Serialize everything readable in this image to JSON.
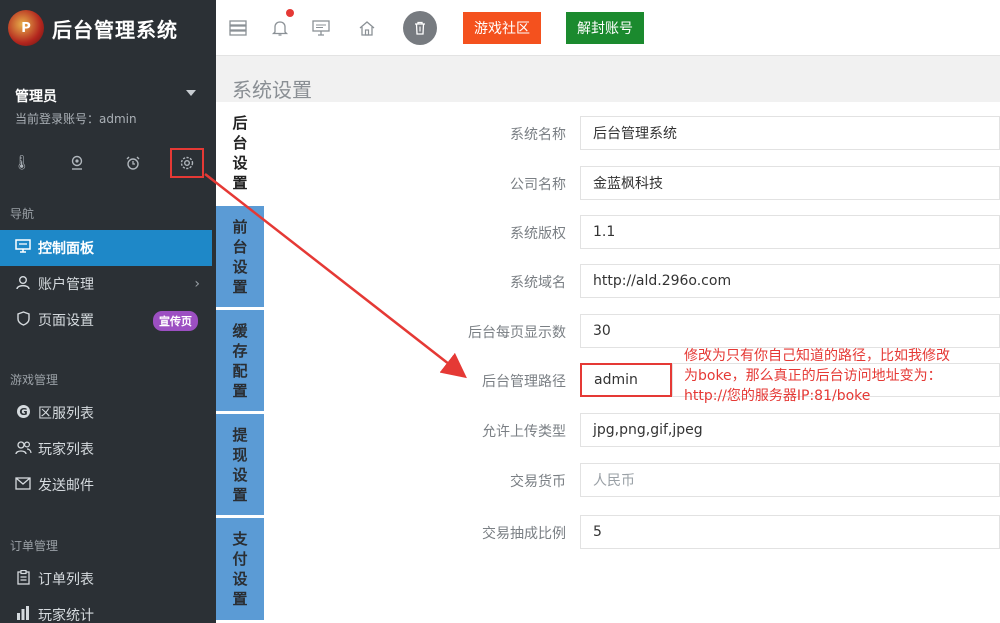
{
  "app": {
    "title": "后台管理系统",
    "logo_text": "P"
  },
  "user": {
    "name": "管理员",
    "login_info": "当前登录账号：admin"
  },
  "quick_icons": [
    "thermometer-icon",
    "location-icon",
    "alarm-icon",
    "gear-icon"
  ],
  "sidebar": {
    "nav_section": "导航",
    "items": [
      {
        "label": "控制面板",
        "icon": "monitor-icon"
      },
      {
        "label": "账户管理",
        "icon": "user-icon",
        "arrow": "›"
      },
      {
        "label": "页面设置",
        "icon": "shield-icon",
        "badge": "宣传页"
      }
    ],
    "game_section": "游戏管理",
    "game_items": [
      {
        "label": "区服列表",
        "icon": "google-icon"
      },
      {
        "label": "玩家列表",
        "icon": "users-icon"
      },
      {
        "label": "发送邮件",
        "icon": "mail-icon"
      }
    ],
    "order_section": "订单管理",
    "order_items": [
      {
        "label": "订单列表",
        "icon": "clipboard-icon"
      },
      {
        "label": "玩家统计",
        "icon": "bar-chart-icon"
      }
    ]
  },
  "topbar": {
    "community_label": "游戏社区",
    "community_color": "#f4511e",
    "unban_label": "解封账号",
    "unban_color": "#1b8a2e"
  },
  "page": {
    "title": "系统设置"
  },
  "tabs": [
    {
      "label": "后台设置"
    },
    {
      "label": "前台设置"
    },
    {
      "label": "缓存配置"
    },
    {
      "label": "提现设置"
    },
    {
      "label": "支付设置"
    }
  ],
  "form": {
    "rows": [
      {
        "label": "系统名称",
        "value": "后台管理系统"
      },
      {
        "label": "公司名称",
        "value": "金蓝枫科技"
      },
      {
        "label": "系统版权",
        "value": "1.1"
      },
      {
        "label": "系统域名",
        "value": "http://ald.296o.com"
      },
      {
        "label": "后台每页显示数",
        "value": "30"
      },
      {
        "label": "后台管理路径",
        "value": "admin"
      },
      {
        "label": "允许上传类型",
        "value": "jpg,png,gif,jpeg"
      },
      {
        "label": "交易货币",
        "value": "",
        "placeholder": "人民币"
      },
      {
        "label": "交易抽成比例",
        "value": "5"
      }
    ]
  },
  "annotation": {
    "line1": "修改为只有你自己知道的路径，比如我修改",
    "line2": "为boke，那么真正的后台访问地址变为：",
    "line3": "http://您的服务器IP:81/boke",
    "color": "#e53935"
  }
}
